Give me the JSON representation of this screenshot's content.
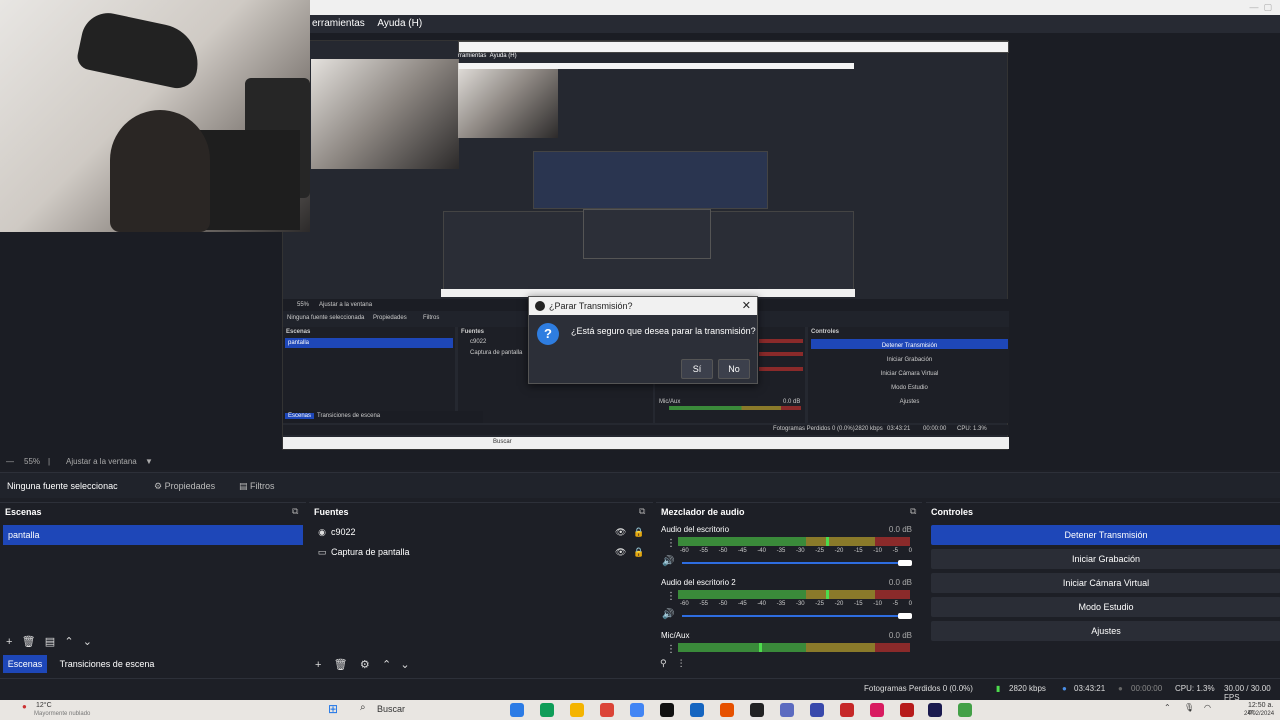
{
  "menu": {
    "items": [
      "erramientas",
      "Ayuda (H)"
    ]
  },
  "dialog": {
    "title": "¿Parar Transmisión?",
    "message": "¿Está seguro que desea parar la transmisión?",
    "yes_label": "Sí",
    "no_label": "No",
    "question_glyph": "?"
  },
  "preview_inner": {
    "source_label": "Ninguna fuente seleccionada",
    "properties": "Propiedades",
    "filters": "Filtros",
    "scenes_title": "Escenas",
    "scene_item": "pantalla",
    "sources_title": "Fuentes",
    "src1": "c9022",
    "src2": "Captura de pantalla",
    "controls_title": "Controles",
    "ctl": [
      "Detener Transmisión",
      "Iniciar Grabación",
      "Iniciar Cámara Virtual",
      "Modo Estudio",
      "Ajustes"
    ],
    "tabs": [
      "Escenas",
      "Transiciones de escena"
    ],
    "mic": "Mic/Aux",
    "db": "0.0 dB",
    "status": "Fotogramas Perdidos 0 (0.0%)",
    "kbps": "2820 kbps",
    "time": "03:43:21",
    "time2": "00:00:00",
    "cpu": "CPU: 1.3%",
    "search": "Buscar",
    "zoom": "55%",
    "fit": "Ajustar a la ventana"
  },
  "zoombar": {
    "zoom": "55%",
    "fit": "Ajustar a la ventana"
  },
  "srcbar": {
    "label": "Ninguna fuente seleccionac",
    "properties": "Propiedades",
    "filters": "Filtros"
  },
  "scenes": {
    "title": "Escenas",
    "selected": "pantalla",
    "tab_active": "Escenas",
    "tab_other": "Transiciones de escena"
  },
  "sources": {
    "title": "Fuentes",
    "items": [
      "c9022",
      "Captura de pantalla"
    ]
  },
  "mixer": {
    "title": "Mezclador de audio",
    "channels": [
      {
        "name": "Audio del escritorio",
        "db": "0.0 dB",
        "level": 0.64,
        "volume": 1.0
      },
      {
        "name": "Audio del escritorio 2",
        "db": "0.0 dB",
        "level": 0.64,
        "volume": 1.0
      },
      {
        "name": "Mic/Aux",
        "db": "0.0 dB",
        "level": 0.35,
        "volume": 1.0
      }
    ],
    "ticks": [
      "-60",
      "-55",
      "-50",
      "-45",
      "-40",
      "-35",
      "-30",
      "-25",
      "-20",
      "-15",
      "-10",
      "-5",
      "0"
    ]
  },
  "controls": {
    "title": "Controles",
    "buttons": [
      "Detener Transmisión",
      "Iniciar Grabación",
      "Iniciar Cámara Virtual",
      "Modo Estudio",
      "Ajustes"
    ]
  },
  "status": {
    "dropped": "Fotogramas Perdidos 0 (0.0%)",
    "kbps": "2820 kbps",
    "live_time": "03:43:21",
    "rec_time": "00:00:00",
    "cpu": "CPU: 1.3%",
    "fps": "30.00 / 30.00 FPS"
  },
  "taskbar": {
    "weather_temp": "12°C",
    "weather_desc": "Mayormente nublado",
    "search": "Buscar",
    "clock_time": "12:50 a. m.",
    "clock_date": "24/02/2024"
  },
  "colors": {
    "accent": "#1e47b8",
    "meter_green": "#3a8a3a",
    "meter_yellow": "#8a7a2a",
    "meter_red": "#8a2a2a"
  }
}
